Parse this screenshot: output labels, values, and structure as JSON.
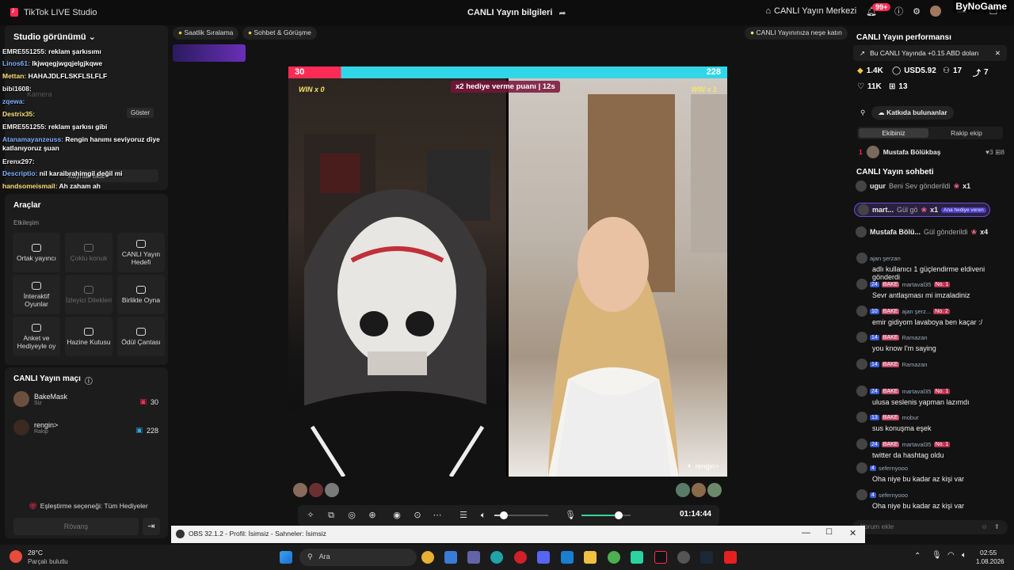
{
  "titlebar": {
    "app_name": "TikTok LIVE Studio",
    "center_title": "CANLI Yayın bilgileri",
    "center_link": "CANLI Yayın Merkezi",
    "notif_badge": "99+",
    "watermark": "ByNoGame"
  },
  "left": {
    "studio_view": "Studio görünümü",
    "chat_overlay": [
      {
        "user": "EMRE551255:",
        "msg": "reklam şarkısımı"
      },
      {
        "user": "Linos61:",
        "msg": "lkjwqegjwgqjelgjkqwe"
      },
      {
        "user": "Mettan:",
        "msg": "HAHAJDLFLSKFLSLFLF"
      },
      {
        "user": "bibi1608:",
        "msg": ""
      },
      {
        "user": "zqewa:",
        "msg": ""
      },
      {
        "user": "Destrix35:",
        "msg": ""
      },
      {
        "user": "EMRE551255:",
        "msg": "reklam şarkısı gibi"
      },
      {
        "user": "Atanamayanzeuss:",
        "msg": "Rengin hanımı seviyoruz diye"
      },
      {
        "user": "",
        "msg": "katlanıyoruz şuan"
      },
      {
        "user": "Erenx297:",
        "msg": ""
      },
      {
        "user": "Descriptio:",
        "msg": "nil karaibrahimgil değil mi"
      },
      {
        "user": "handsomeismail:",
        "msg": "Ah zaham ah"
      }
    ],
    "ghost_labels": {
      "kamera": "Kamera",
      "goster": "Göster",
      "kaynak": "Kaynak ekle"
    },
    "tools_title": "Araçlar",
    "tools_sub": "Etkileşim",
    "tools": [
      {
        "label": "Ortak yayıncı",
        "disabled": false
      },
      {
        "label": "Çoklu konuk",
        "disabled": true
      },
      {
        "label": "CANLI Yayın Hedefi",
        "disabled": false
      },
      {
        "label": "İnteraktif Oyunlar",
        "disabled": false
      },
      {
        "label": "İzleyici Dilekleri",
        "disabled": true
      },
      {
        "label": "Birlikte Oyna",
        "disabled": false
      },
      {
        "label": "Anket ve Hediyeyle oy",
        "disabled": false
      },
      {
        "label": "Hazine Kutusu",
        "disabled": false
      },
      {
        "label": "Ödül Çantası",
        "disabled": false
      }
    ],
    "match_title": "CANLI Yayın maçı",
    "players": [
      {
        "name": "BakeMask",
        "sub": "Siz",
        "score": "30"
      },
      {
        "name": "rengin>",
        "sub": "Rakip",
        "score": "228"
      }
    ],
    "pairing": "Eşleştirme seçeneği: Tüm Hediyeler",
    "rematch": "Rövanş"
  },
  "topbar": {
    "ranking": "Saatlik Sıralama",
    "chat_meet": "Sohbet & Görüşme",
    "tip": "CANLI Yayınınıza neşe katın"
  },
  "stage": {
    "score_left": "30",
    "score_right": "228",
    "multiplier": "x2 hediye verme puanı",
    "countdown": "12s",
    "win_left": "WIN x 0",
    "win_right": "WIN x 1",
    "right_label": "rengin>",
    "timer": "01:14:44",
    "bar_fill_left": 0.12,
    "volume_level": 0.18,
    "mic_level": 0.75
  },
  "right": {
    "perf_title": "CANLI Yayın performansı",
    "banner": "Bu CANLI Yayında +0.15 ABD doları",
    "stats": {
      "likes": "1.4K",
      "usd": "USD5.92",
      "users": "17",
      "shares": "7",
      "views": "11K",
      "gifts": "13"
    },
    "contributors": "Katkıda bulunanlar",
    "tab_team": "Ekibiniz",
    "tab_rival": "Rakip ekip",
    "top_contrib": {
      "rank": "1",
      "name": "Mustafa Bölükbaş",
      "a": "3",
      "b": "8"
    },
    "chat_title": "CANLI Yayın sohbeti",
    "gifts": [
      {
        "user": "ugur",
        "action": "Beni Sev gönderildi",
        "count": "x1",
        "tag": ""
      },
      {
        "user": "mart...",
        "action": "Gül gö",
        "count": "x1",
        "tag": "Ana hediye veren"
      },
      {
        "user": "Mustafa Bölü...",
        "action": "Gül gönderildi",
        "count": "x4",
        "tag": ""
      }
    ],
    "comments": [
      {
        "lvl": "",
        "team": "",
        "user": "ajan şerzan",
        "rank": "",
        "text": "adlı kullanıcı 1 güçlendirme eldiveni gönderdi"
      },
      {
        "lvl": "24",
        "team": "BAKE",
        "user": "martaval35",
        "rank": "No. 1",
        "text": "Sevr antlaşması mi imzaladiniz"
      },
      {
        "lvl": "10",
        "team": "BAKE",
        "user": "ajan şerz...",
        "rank": "No. 2",
        "text": "emir gidiyom lavaboya ben kaçar :/"
      },
      {
        "lvl": "14",
        "team": "BAKE",
        "user": "Ramazan",
        "rank": "",
        "text": "you know I'm saying"
      },
      {
        "lvl": "14",
        "team": "BAKE",
        "user": "Ramazan",
        "rank": "",
        "text": ""
      },
      {
        "lvl": "24",
        "team": "BAKE",
        "user": "martaval35",
        "rank": "No. 1",
        "text": "ulusa seslenis yapman lazımdı"
      },
      {
        "lvl": "13",
        "team": "BAKE",
        "user": "mobur",
        "rank": "",
        "text": "sus konuşma eşek"
      },
      {
        "lvl": "24",
        "team": "BAKE",
        "user": "martaval35",
        "rank": "No. 1",
        "text": "twitter da hashtag oldu"
      },
      {
        "lvl": "4",
        "team": "",
        "user": "sefernyooo",
        "rank": "",
        "text": "Oha niye bu kadar az kişi var"
      },
      {
        "lvl": "4",
        "team": "",
        "user": "sefernyooo",
        "rank": "",
        "text": "Oha niye bu kadar az kişi var"
      }
    ],
    "comment_placeholder": "Yorum ekle"
  },
  "obs": {
    "title": "OBS 32.1.2 - Profil: İsimsiz - Sahneler: İsimsiz"
  },
  "taskbar": {
    "temp": "28°C",
    "weather": "Parçalı bulutlu",
    "search": "Ara",
    "time": "02:55",
    "date": "1.08.2026"
  },
  "colors": {
    "accent": "#fe2c55",
    "cyan": "#31d6e8",
    "panel": "#1c1c1c"
  }
}
